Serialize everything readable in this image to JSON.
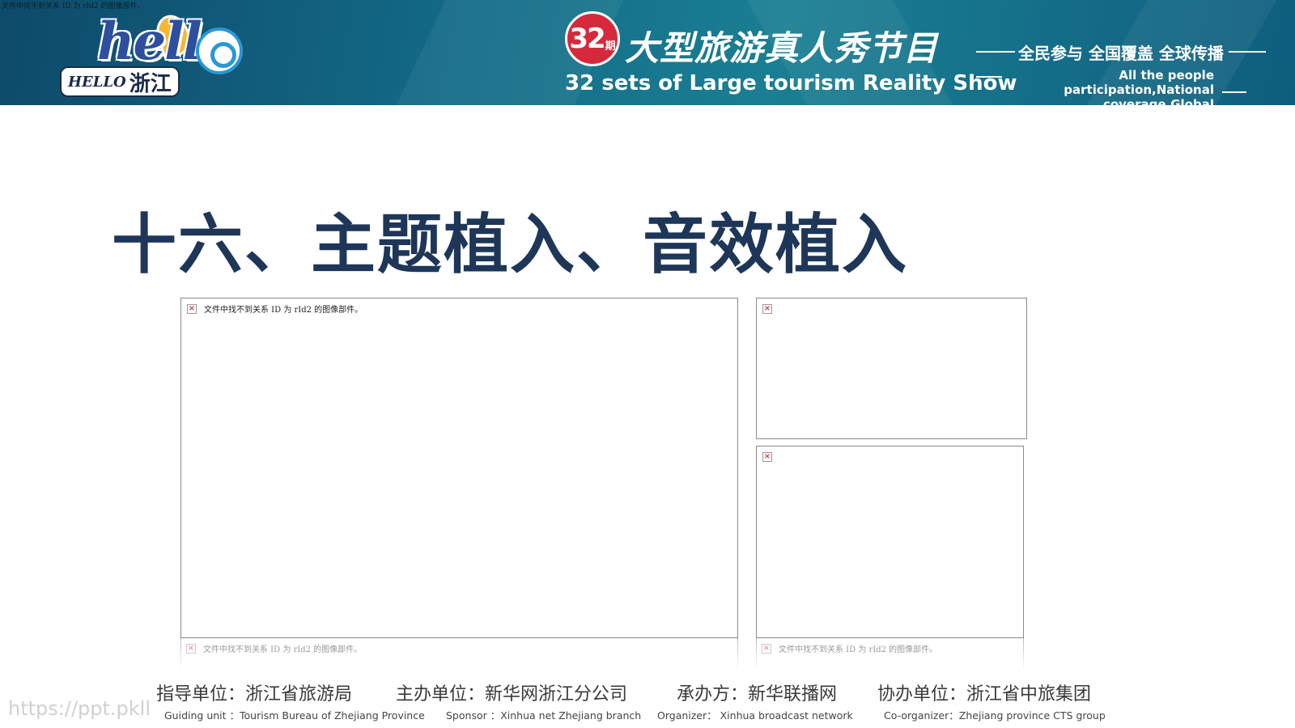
{
  "banner": {
    "broken_image_text": "文件中找不到关系 ID 为 rId2 的图像部件。",
    "logo": {
      "word_en": "HELLO",
      "word_cn": "浙江",
      "word_art": "hello"
    },
    "badge": {
      "number": "32",
      "suffix": "期"
    },
    "title_cn": "大型旅游真人秀节目",
    "title_en": "32 sets of Large tourism Reality Show",
    "slogan_cn": "全民参与 全国覆盖 全球传播",
    "slogan_en_line1": "All the people participation,National",
    "slogan_en_line2": "coverage,Global Communication"
  },
  "heading": "十六、主题植入、音效植入",
  "placeholders": {
    "main_message": "文件中找不到关系 ID 为 rId2 的图像部件。",
    "ghost_left_message": "文件中找不到关系 ID 为 rId2 的图像部件。",
    "ghost_right_message": "文件中找不到关系 ID 为 rId2 的图像部件。",
    "icon_glyph": "×"
  },
  "footer": [
    {
      "cn": "指导单位：浙江省旅游局",
      "en": "Guiding unit ：Tourism Bureau of Zhejiang Province"
    },
    {
      "cn": "主办单位：新华网浙江分公司",
      "en": "Sponsor ：Xinhua net Zhejiang branch"
    },
    {
      "cn": "承办方：新华联播网",
      "en": "Organizer： Xinhua broadcast  network"
    },
    {
      "cn": "协办单位：浙江省中旅集团",
      "en": "Co-organizer：Zhejiang province CTS group"
    }
  ],
  "watermark": "https://ppt.pkll",
  "colors": {
    "banner": "#136a86",
    "heading": "#1e3658",
    "badge": "#d62a3c"
  }
}
